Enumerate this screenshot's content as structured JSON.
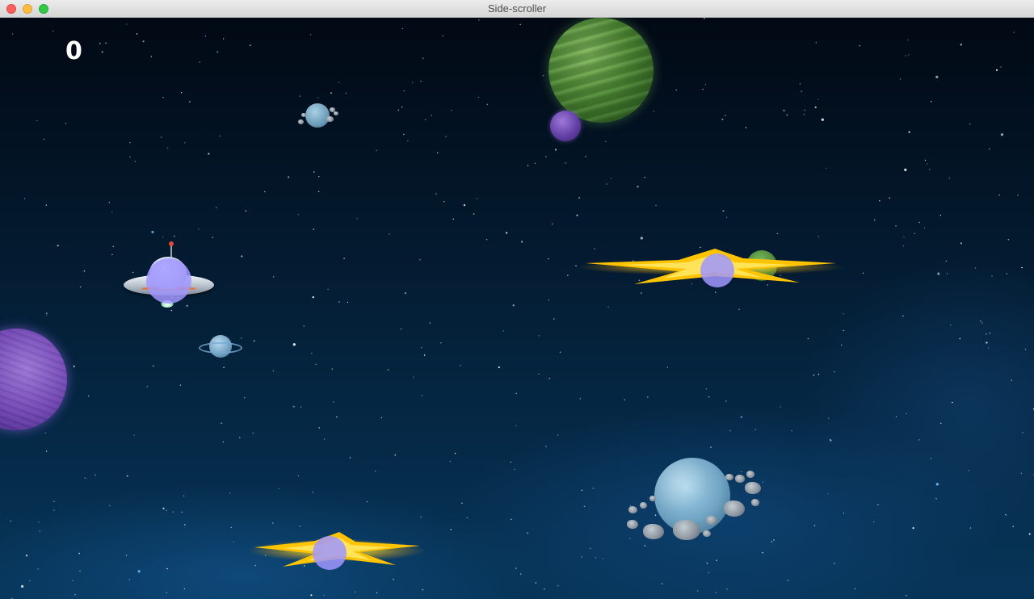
{
  "window": {
    "title": "Side-scroller"
  },
  "hud": {
    "score": "0"
  },
  "colors": {
    "space_top": "#020914",
    "space_bottom": "#073559",
    "hitbox": "#a096ff",
    "star_missile": "#ffcc00"
  },
  "sprites": {
    "player": "ufo-icon",
    "projectiles": [
      "star-missile-icon",
      "star-missile-icon"
    ],
    "background": [
      "green-planet-icon",
      "purple-planet-icon",
      "asteroid-planet-icon",
      "ringed-planet-icon",
      "ice-planet-icon"
    ]
  }
}
